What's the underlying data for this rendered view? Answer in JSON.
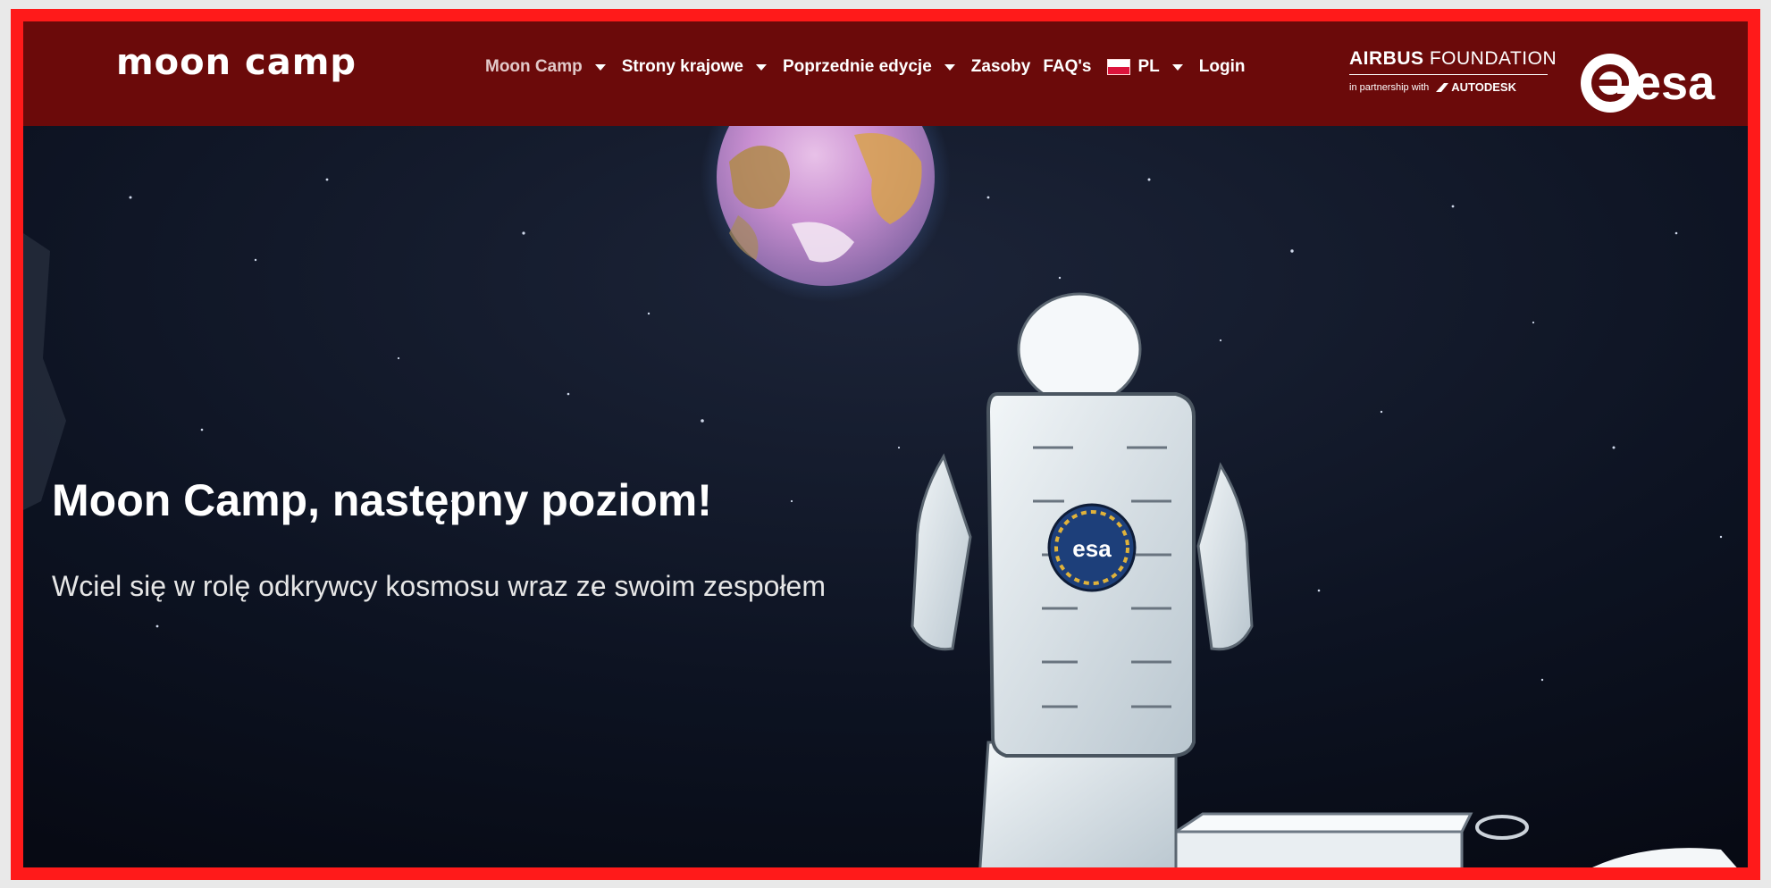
{
  "brand": {
    "logo_text": "moon camp"
  },
  "nav": {
    "items": [
      {
        "label": "Moon Camp",
        "dropdown": true,
        "active": true
      },
      {
        "label": "Strony krajowe",
        "dropdown": true
      },
      {
        "label": "Poprzednie edycje",
        "dropdown": true
      },
      {
        "label": "Zasoby",
        "dropdown": false
      },
      {
        "label": "FAQ's",
        "dropdown": false
      }
    ],
    "language": {
      "label": "PL",
      "flag": "poland-flag-icon"
    },
    "login": "Login"
  },
  "partners": {
    "airbus_bold": "AIRBUS",
    "airbus_light": "FOUNDATION",
    "partnership": "in partnership with",
    "autodesk": "AUTODESK",
    "esa": "esa"
  },
  "hero": {
    "title": "Moon Camp, następny poziom!",
    "subtitle": "Wciel się w rolę odkrywcy kosmosu wraz ze swoim zespołem",
    "backpack_logo": "esa"
  },
  "colors": {
    "navbar": "#6b0a0a",
    "frame_border": "#ff1a1a",
    "sky": "#0a0f1c"
  }
}
